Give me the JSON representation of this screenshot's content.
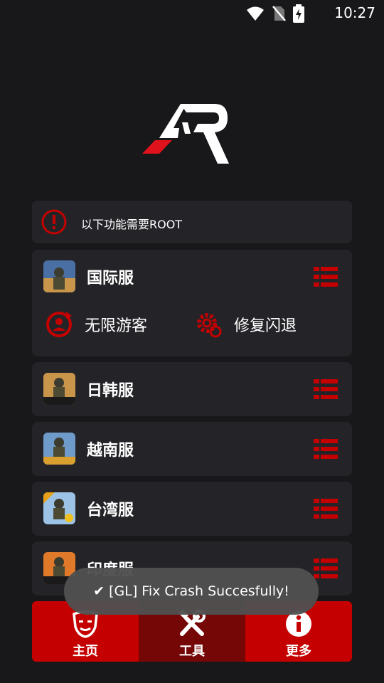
{
  "status_bar": {
    "time": "10:27"
  },
  "notice": {
    "text": "以下功能需要ROOT"
  },
  "servers": [
    {
      "name": "国际服"
    },
    {
      "name": "日韩服"
    },
    {
      "name": "越南服"
    },
    {
      "name": "台湾服"
    },
    {
      "name": "印度服"
    }
  ],
  "features": {
    "guest": "无限游客",
    "fix_crash": "修复闪退"
  },
  "bottom_nav": {
    "home": "主页",
    "tools": "工具",
    "more": "更多"
  },
  "toast": {
    "text": "✔ [GL] Fix Crash Succesfully!"
  },
  "colors": {
    "accent": "#c40000",
    "active_tab": "#750707",
    "card": "#242428",
    "background": "#18181a"
  }
}
